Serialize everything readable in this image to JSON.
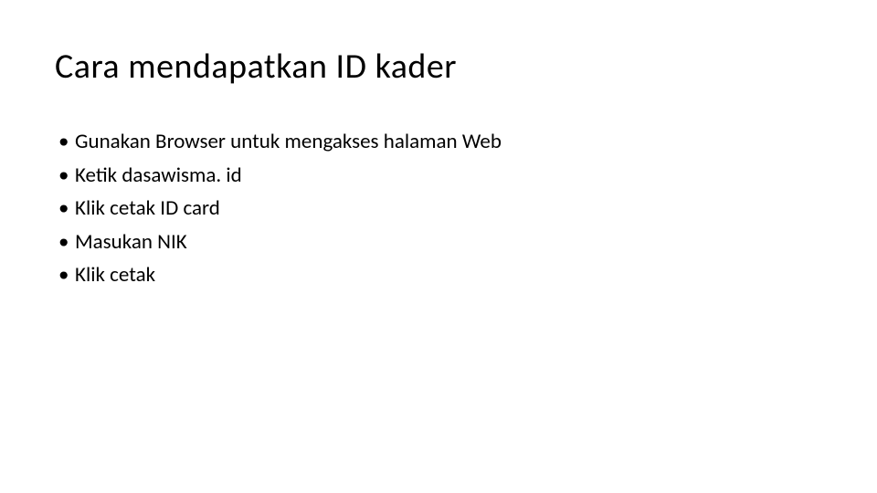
{
  "slide": {
    "title": "Cara mendapatkan ID kader",
    "bullets": [
      "Gunakan Browser untuk mengakses halaman Web",
      "Ketik dasawisma. id",
      "Klik cetak ID card",
      "Masukan NIK",
      "Klik cetak"
    ]
  }
}
